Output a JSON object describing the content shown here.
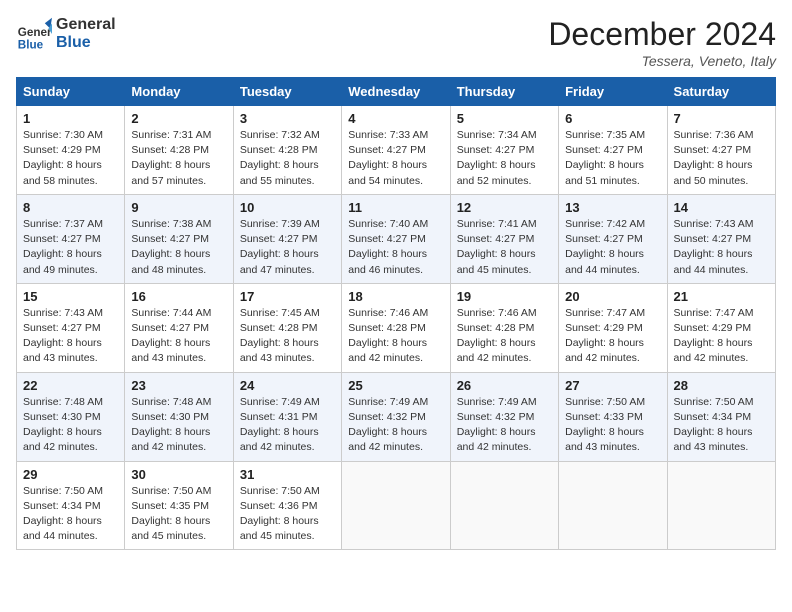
{
  "header": {
    "logo_line1": "General",
    "logo_line2": "Blue",
    "month_title": "December 2024",
    "location": "Tessera, Veneto, Italy"
  },
  "columns": [
    "Sunday",
    "Monday",
    "Tuesday",
    "Wednesday",
    "Thursday",
    "Friday",
    "Saturday"
  ],
  "weeks": [
    [
      {
        "day": "1",
        "sunrise": "Sunrise: 7:30 AM",
        "sunset": "Sunset: 4:29 PM",
        "daylight": "Daylight: 8 hours and 58 minutes."
      },
      {
        "day": "2",
        "sunrise": "Sunrise: 7:31 AM",
        "sunset": "Sunset: 4:28 PM",
        "daylight": "Daylight: 8 hours and 57 minutes."
      },
      {
        "day": "3",
        "sunrise": "Sunrise: 7:32 AM",
        "sunset": "Sunset: 4:28 PM",
        "daylight": "Daylight: 8 hours and 55 minutes."
      },
      {
        "day": "4",
        "sunrise": "Sunrise: 7:33 AM",
        "sunset": "Sunset: 4:27 PM",
        "daylight": "Daylight: 8 hours and 54 minutes."
      },
      {
        "day": "5",
        "sunrise": "Sunrise: 7:34 AM",
        "sunset": "Sunset: 4:27 PM",
        "daylight": "Daylight: 8 hours and 52 minutes."
      },
      {
        "day": "6",
        "sunrise": "Sunrise: 7:35 AM",
        "sunset": "Sunset: 4:27 PM",
        "daylight": "Daylight: 8 hours and 51 minutes."
      },
      {
        "day": "7",
        "sunrise": "Sunrise: 7:36 AM",
        "sunset": "Sunset: 4:27 PM",
        "daylight": "Daylight: 8 hours and 50 minutes."
      }
    ],
    [
      {
        "day": "8",
        "sunrise": "Sunrise: 7:37 AM",
        "sunset": "Sunset: 4:27 PM",
        "daylight": "Daylight: 8 hours and 49 minutes."
      },
      {
        "day": "9",
        "sunrise": "Sunrise: 7:38 AM",
        "sunset": "Sunset: 4:27 PM",
        "daylight": "Daylight: 8 hours and 48 minutes."
      },
      {
        "day": "10",
        "sunrise": "Sunrise: 7:39 AM",
        "sunset": "Sunset: 4:27 PM",
        "daylight": "Daylight: 8 hours and 47 minutes."
      },
      {
        "day": "11",
        "sunrise": "Sunrise: 7:40 AM",
        "sunset": "Sunset: 4:27 PM",
        "daylight": "Daylight: 8 hours and 46 minutes."
      },
      {
        "day": "12",
        "sunrise": "Sunrise: 7:41 AM",
        "sunset": "Sunset: 4:27 PM",
        "daylight": "Daylight: 8 hours and 45 minutes."
      },
      {
        "day": "13",
        "sunrise": "Sunrise: 7:42 AM",
        "sunset": "Sunset: 4:27 PM",
        "daylight": "Daylight: 8 hours and 44 minutes."
      },
      {
        "day": "14",
        "sunrise": "Sunrise: 7:43 AM",
        "sunset": "Sunset: 4:27 PM",
        "daylight": "Daylight: 8 hours and 44 minutes."
      }
    ],
    [
      {
        "day": "15",
        "sunrise": "Sunrise: 7:43 AM",
        "sunset": "Sunset: 4:27 PM",
        "daylight": "Daylight: 8 hours and 43 minutes."
      },
      {
        "day": "16",
        "sunrise": "Sunrise: 7:44 AM",
        "sunset": "Sunset: 4:27 PM",
        "daylight": "Daylight: 8 hours and 43 minutes."
      },
      {
        "day": "17",
        "sunrise": "Sunrise: 7:45 AM",
        "sunset": "Sunset: 4:28 PM",
        "daylight": "Daylight: 8 hours and 43 minutes."
      },
      {
        "day": "18",
        "sunrise": "Sunrise: 7:46 AM",
        "sunset": "Sunset: 4:28 PM",
        "daylight": "Daylight: 8 hours and 42 minutes."
      },
      {
        "day": "19",
        "sunrise": "Sunrise: 7:46 AM",
        "sunset": "Sunset: 4:28 PM",
        "daylight": "Daylight: 8 hours and 42 minutes."
      },
      {
        "day": "20",
        "sunrise": "Sunrise: 7:47 AM",
        "sunset": "Sunset: 4:29 PM",
        "daylight": "Daylight: 8 hours and 42 minutes."
      },
      {
        "day": "21",
        "sunrise": "Sunrise: 7:47 AM",
        "sunset": "Sunset: 4:29 PM",
        "daylight": "Daylight: 8 hours and 42 minutes."
      }
    ],
    [
      {
        "day": "22",
        "sunrise": "Sunrise: 7:48 AM",
        "sunset": "Sunset: 4:30 PM",
        "daylight": "Daylight: 8 hours and 42 minutes."
      },
      {
        "day": "23",
        "sunrise": "Sunrise: 7:48 AM",
        "sunset": "Sunset: 4:30 PM",
        "daylight": "Daylight: 8 hours and 42 minutes."
      },
      {
        "day": "24",
        "sunrise": "Sunrise: 7:49 AM",
        "sunset": "Sunset: 4:31 PM",
        "daylight": "Daylight: 8 hours and 42 minutes."
      },
      {
        "day": "25",
        "sunrise": "Sunrise: 7:49 AM",
        "sunset": "Sunset: 4:32 PM",
        "daylight": "Daylight: 8 hours and 42 minutes."
      },
      {
        "day": "26",
        "sunrise": "Sunrise: 7:49 AM",
        "sunset": "Sunset: 4:32 PM",
        "daylight": "Daylight: 8 hours and 42 minutes."
      },
      {
        "day": "27",
        "sunrise": "Sunrise: 7:50 AM",
        "sunset": "Sunset: 4:33 PM",
        "daylight": "Daylight: 8 hours and 43 minutes."
      },
      {
        "day": "28",
        "sunrise": "Sunrise: 7:50 AM",
        "sunset": "Sunset: 4:34 PM",
        "daylight": "Daylight: 8 hours and 43 minutes."
      }
    ],
    [
      {
        "day": "29",
        "sunrise": "Sunrise: 7:50 AM",
        "sunset": "Sunset: 4:34 PM",
        "daylight": "Daylight: 8 hours and 44 minutes."
      },
      {
        "day": "30",
        "sunrise": "Sunrise: 7:50 AM",
        "sunset": "Sunset: 4:35 PM",
        "daylight": "Daylight: 8 hours and 45 minutes."
      },
      {
        "day": "31",
        "sunrise": "Sunrise: 7:50 AM",
        "sunset": "Sunset: 4:36 PM",
        "daylight": "Daylight: 8 hours and 45 minutes."
      },
      null,
      null,
      null,
      null
    ]
  ]
}
